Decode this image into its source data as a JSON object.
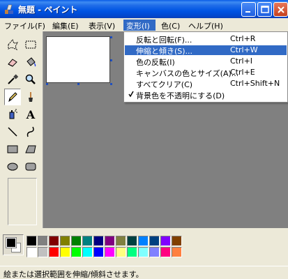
{
  "window": {
    "title": "無題 - ペイント"
  },
  "menubar": {
    "items": [
      {
        "label": "ファイル(F)"
      },
      {
        "label": "編集(E)"
      },
      {
        "label": "表示(V)"
      },
      {
        "label": "変形(I)"
      },
      {
        "label": "色(C)"
      },
      {
        "label": "ヘルプ(H)"
      }
    ]
  },
  "image_menu": {
    "items": [
      {
        "label": "反転と回転(F)...",
        "shortcut": "Ctrl+R"
      },
      {
        "label": "伸縮と傾き(S)...",
        "shortcut": "Ctrl+W"
      },
      {
        "label": "色の反転(I)",
        "shortcut": "Ctrl+I"
      },
      {
        "label": "キャンバスの色とサイズ(A)...",
        "shortcut": "Ctrl+E"
      },
      {
        "label": "すべてクリア(C)",
        "shortcut": "Ctrl+Shift+N"
      },
      {
        "label": "背景色を不透明にする(D)",
        "shortcut": ""
      }
    ]
  },
  "tools": [
    {
      "icon": "free-select-icon"
    },
    {
      "icon": "rect-select-icon"
    },
    {
      "icon": "eraser-icon"
    },
    {
      "icon": "fill-icon"
    },
    {
      "icon": "color-picker-icon"
    },
    {
      "icon": "magnifier-icon"
    },
    {
      "icon": "pencil-icon"
    },
    {
      "icon": "brush-icon"
    },
    {
      "icon": "airbrush-icon"
    },
    {
      "icon": "text-icon"
    },
    {
      "icon": "line-icon"
    },
    {
      "icon": "curve-icon"
    },
    {
      "icon": "rectangle-icon"
    },
    {
      "icon": "polygon-icon"
    },
    {
      "icon": "ellipse-icon"
    },
    {
      "icon": "rounded-rect-icon"
    }
  ],
  "text_tool_glyph": "A",
  "palette": {
    "row1": [
      "#000000",
      "#808080",
      "#800000",
      "#808000",
      "#008000",
      "#008080",
      "#000080",
      "#800080",
      "#808040",
      "#004040",
      "#0080ff",
      "#004080",
      "#8000ff",
      "#804000"
    ],
    "row2": [
      "#ffffff",
      "#c0c0c0",
      "#ff0000",
      "#ffff00",
      "#00ff00",
      "#00ffff",
      "#0000ff",
      "#ff00ff",
      "#ffff80",
      "#00ff80",
      "#80ffff",
      "#8080ff",
      "#ff0080",
      "#ff8040"
    ]
  },
  "status": {
    "text": "絵または選択範囲を伸縮/傾斜させます。"
  }
}
